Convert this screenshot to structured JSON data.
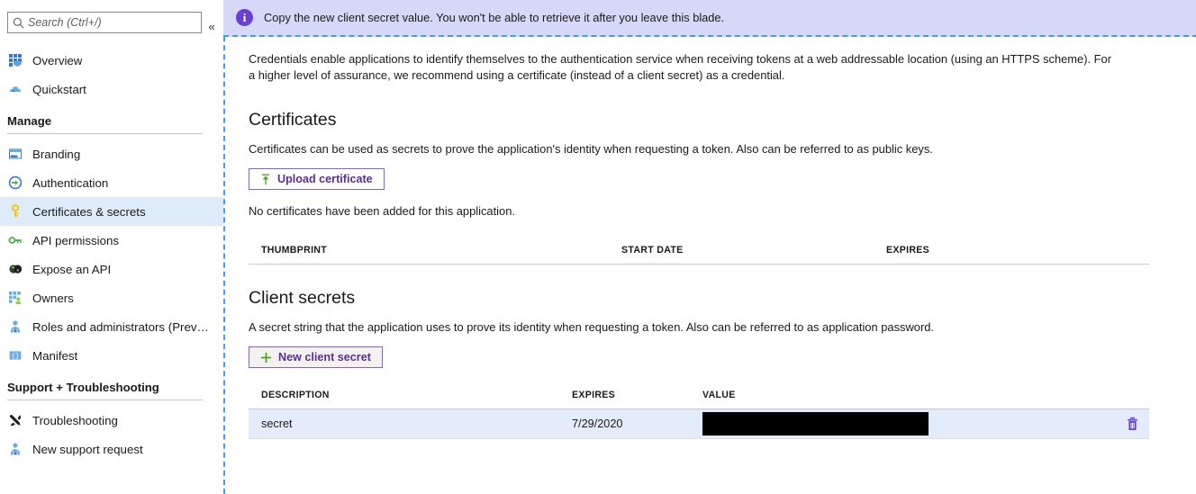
{
  "sidebar": {
    "search": {
      "placeholder": "Search (Ctrl+/)",
      "value": "",
      "icon": "search-icon"
    },
    "collapse_label": "«",
    "items": [
      {
        "label": "Overview",
        "icon": "overview-grid-icon",
        "selected": false
      },
      {
        "label": "Quickstart",
        "icon": "quickstart-cloud-icon",
        "selected": false
      }
    ],
    "sections": [
      {
        "title": "Manage",
        "items": [
          {
            "label": "Branding",
            "icon": "branding-window-icon",
            "selected": false
          },
          {
            "label": "Authentication",
            "icon": "authentication-arrow-icon",
            "selected": false
          },
          {
            "label": "Certificates & secrets",
            "icon": "key-icon",
            "selected": true
          },
          {
            "label": "API permissions",
            "icon": "api-permissions-key-icon",
            "selected": false
          },
          {
            "label": "Expose an API",
            "icon": "expose-api-icon",
            "selected": false
          },
          {
            "label": "Owners",
            "icon": "owners-grid-icon",
            "selected": false
          },
          {
            "label": "Roles and administrators (Previ...",
            "icon": "roles-person-icon",
            "selected": false
          },
          {
            "label": "Manifest",
            "icon": "manifest-icon",
            "selected": false
          }
        ]
      },
      {
        "title": "Support + Troubleshooting",
        "items": [
          {
            "label": "Troubleshooting",
            "icon": "troubleshooting-tools-icon",
            "selected": false
          },
          {
            "label": "New support request",
            "icon": "support-person-icon",
            "selected": false
          }
        ]
      }
    ]
  },
  "banner": {
    "icon": "info-icon",
    "text": "Copy the new client secret value. You won't be able to retrieve it after you leave this blade.",
    "background": "#d5d9f7",
    "icon_color": "#6b3fd4"
  },
  "main": {
    "intro": "Credentials enable applications to identify themselves to the authentication service when receiving tokens at a web addressable location (using an HTTPS scheme). For a higher level of assurance, we recommend using a certificate (instead of a client secret) as a credential.",
    "certificates": {
      "title": "Certificates",
      "description": "Certificates can be used as secrets to prove the application's identity when requesting a token. Also can be referred to as public keys.",
      "upload_button": "Upload certificate",
      "upload_icon": "upload-arrow-icon",
      "empty_note": "No certificates have been added for this application.",
      "columns": [
        "THUMBPRINT",
        "START DATE",
        "EXPIRES"
      ],
      "rows": []
    },
    "client_secrets": {
      "title": "Client secrets",
      "description": "A secret string that the application uses to prove its identity when requesting a token. Also can be referred to as application password.",
      "new_button": "New client secret",
      "new_icon": "plus-icon",
      "columns": [
        "DESCRIPTION",
        "EXPIRES",
        "VALUE"
      ],
      "rows": [
        {
          "description": "secret",
          "expires": "7/29/2020",
          "value": "",
          "value_redacted": true,
          "delete_icon": "trash-icon"
        }
      ]
    }
  },
  "colors": {
    "accent_purple": "#5c2d91",
    "button_border": "#8661c5",
    "row_highlight": "#e4ebfa",
    "selected_nav": "#deecf9",
    "dashed_border": "#4a9ae6",
    "icon_green": "#49a01e"
  }
}
